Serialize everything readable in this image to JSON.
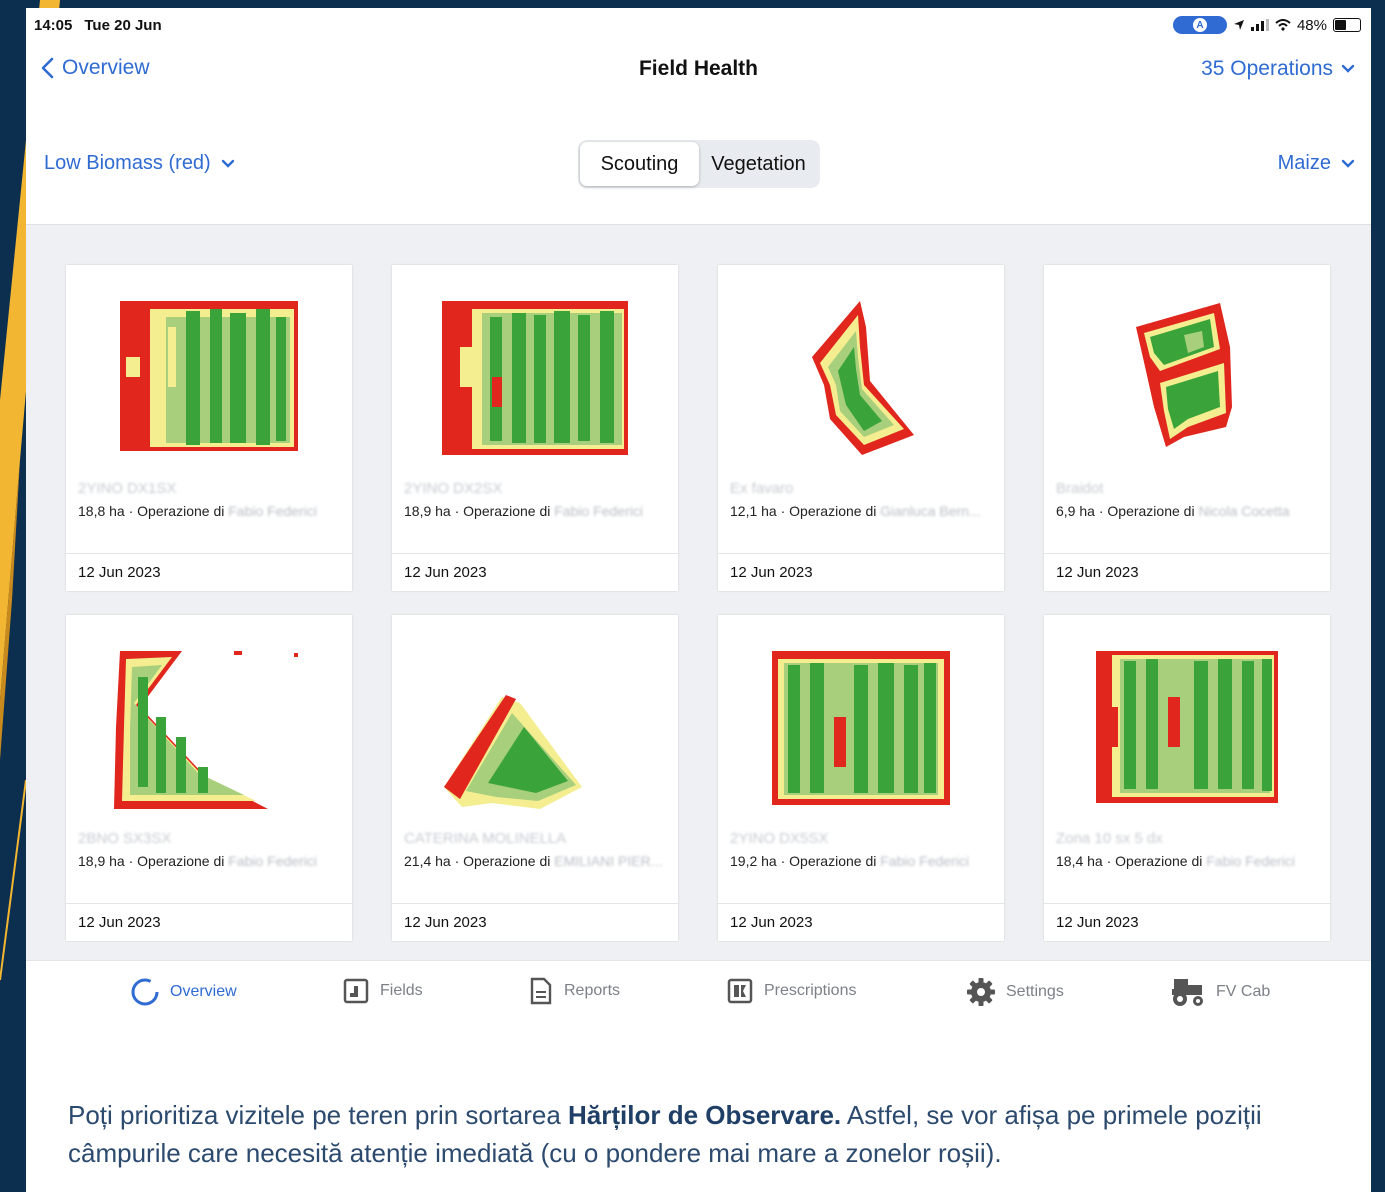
{
  "status_bar": {
    "time": "14:05",
    "date": "Tue 20 Jun",
    "battery": "48%"
  },
  "nav": {
    "back_label": "Overview",
    "title": "Field Health",
    "operations_label": "35 Operations"
  },
  "filters": {
    "layer_label": "Low Biomass (red)",
    "segments": [
      "Scouting",
      "Vegetation"
    ],
    "active_segment": "Scouting",
    "crop_label": "Maize"
  },
  "colors": {
    "accent": "#2f6bd2",
    "map_red": "#e0261d",
    "map_yellow": "#f4ee90",
    "map_light_green": "#a8cf7c",
    "map_green": "#3aa33a"
  },
  "cards": [
    {
      "name": "2YINO DX1SX",
      "area": "18,8 ha",
      "operation_prefix": "Operazione di",
      "operator": "Fabio Federici",
      "date": "12 Jun 2023"
    },
    {
      "name": "2YINO DX2SX",
      "area": "18,9 ha",
      "operation_prefix": "Operazione di",
      "operator": "Fabio Federici",
      "date": "12 Jun 2023"
    },
    {
      "name": "Ex favaro",
      "area": "12,1 ha",
      "operation_prefix": "Operazione di",
      "operator": "Gianluca Bern...",
      "date": "12 Jun 2023"
    },
    {
      "name": "Braidot",
      "area": "6,9 ha",
      "operation_prefix": "Operazione di",
      "operator": "Nicola Cocetta",
      "date": "12 Jun 2023"
    },
    {
      "name": "2BNO SX3SX",
      "area": "18,9 ha",
      "operation_prefix": "Operazione di",
      "operator": "Fabio Federici",
      "date": "12 Jun 2023"
    },
    {
      "name": "CATERINA MOLINELLA",
      "area": "21,4 ha",
      "operation_prefix": "Operazione di",
      "operator": "EMILIANI PIER...",
      "date": "12 Jun 2023"
    },
    {
      "name": "2YINO DX5SX",
      "area": "19,2 ha",
      "operation_prefix": "Operazione di",
      "operator": "Fabio Federici",
      "date": "12 Jun 2023"
    },
    {
      "name": "Zona 10 sx 5 dx",
      "area": "18,4 ha",
      "operation_prefix": "Operazione di",
      "operator": "Fabio Federici",
      "date": "12 Jun 2023"
    }
  ],
  "tabs": [
    {
      "label": "Overview",
      "icon": "overview-ring-icon"
    },
    {
      "label": "Fields",
      "icon": "fields-icon"
    },
    {
      "label": "Reports",
      "icon": "document-icon"
    },
    {
      "label": "Prescriptions",
      "icon": "prescription-icon"
    },
    {
      "label": "Settings",
      "icon": "gear-icon"
    },
    {
      "label": "FV Cab",
      "icon": "tractor-icon"
    }
  ],
  "caption": {
    "before": "Poți prioritiza vizitele pe teren prin sortarea ",
    "bold": "Hărților de Observare.",
    "after": " Astfel, se vor afișa pe primele poziții câmpurile care necesită atenție imediată (cu o pondere mai mare a zonelor roșii)."
  }
}
